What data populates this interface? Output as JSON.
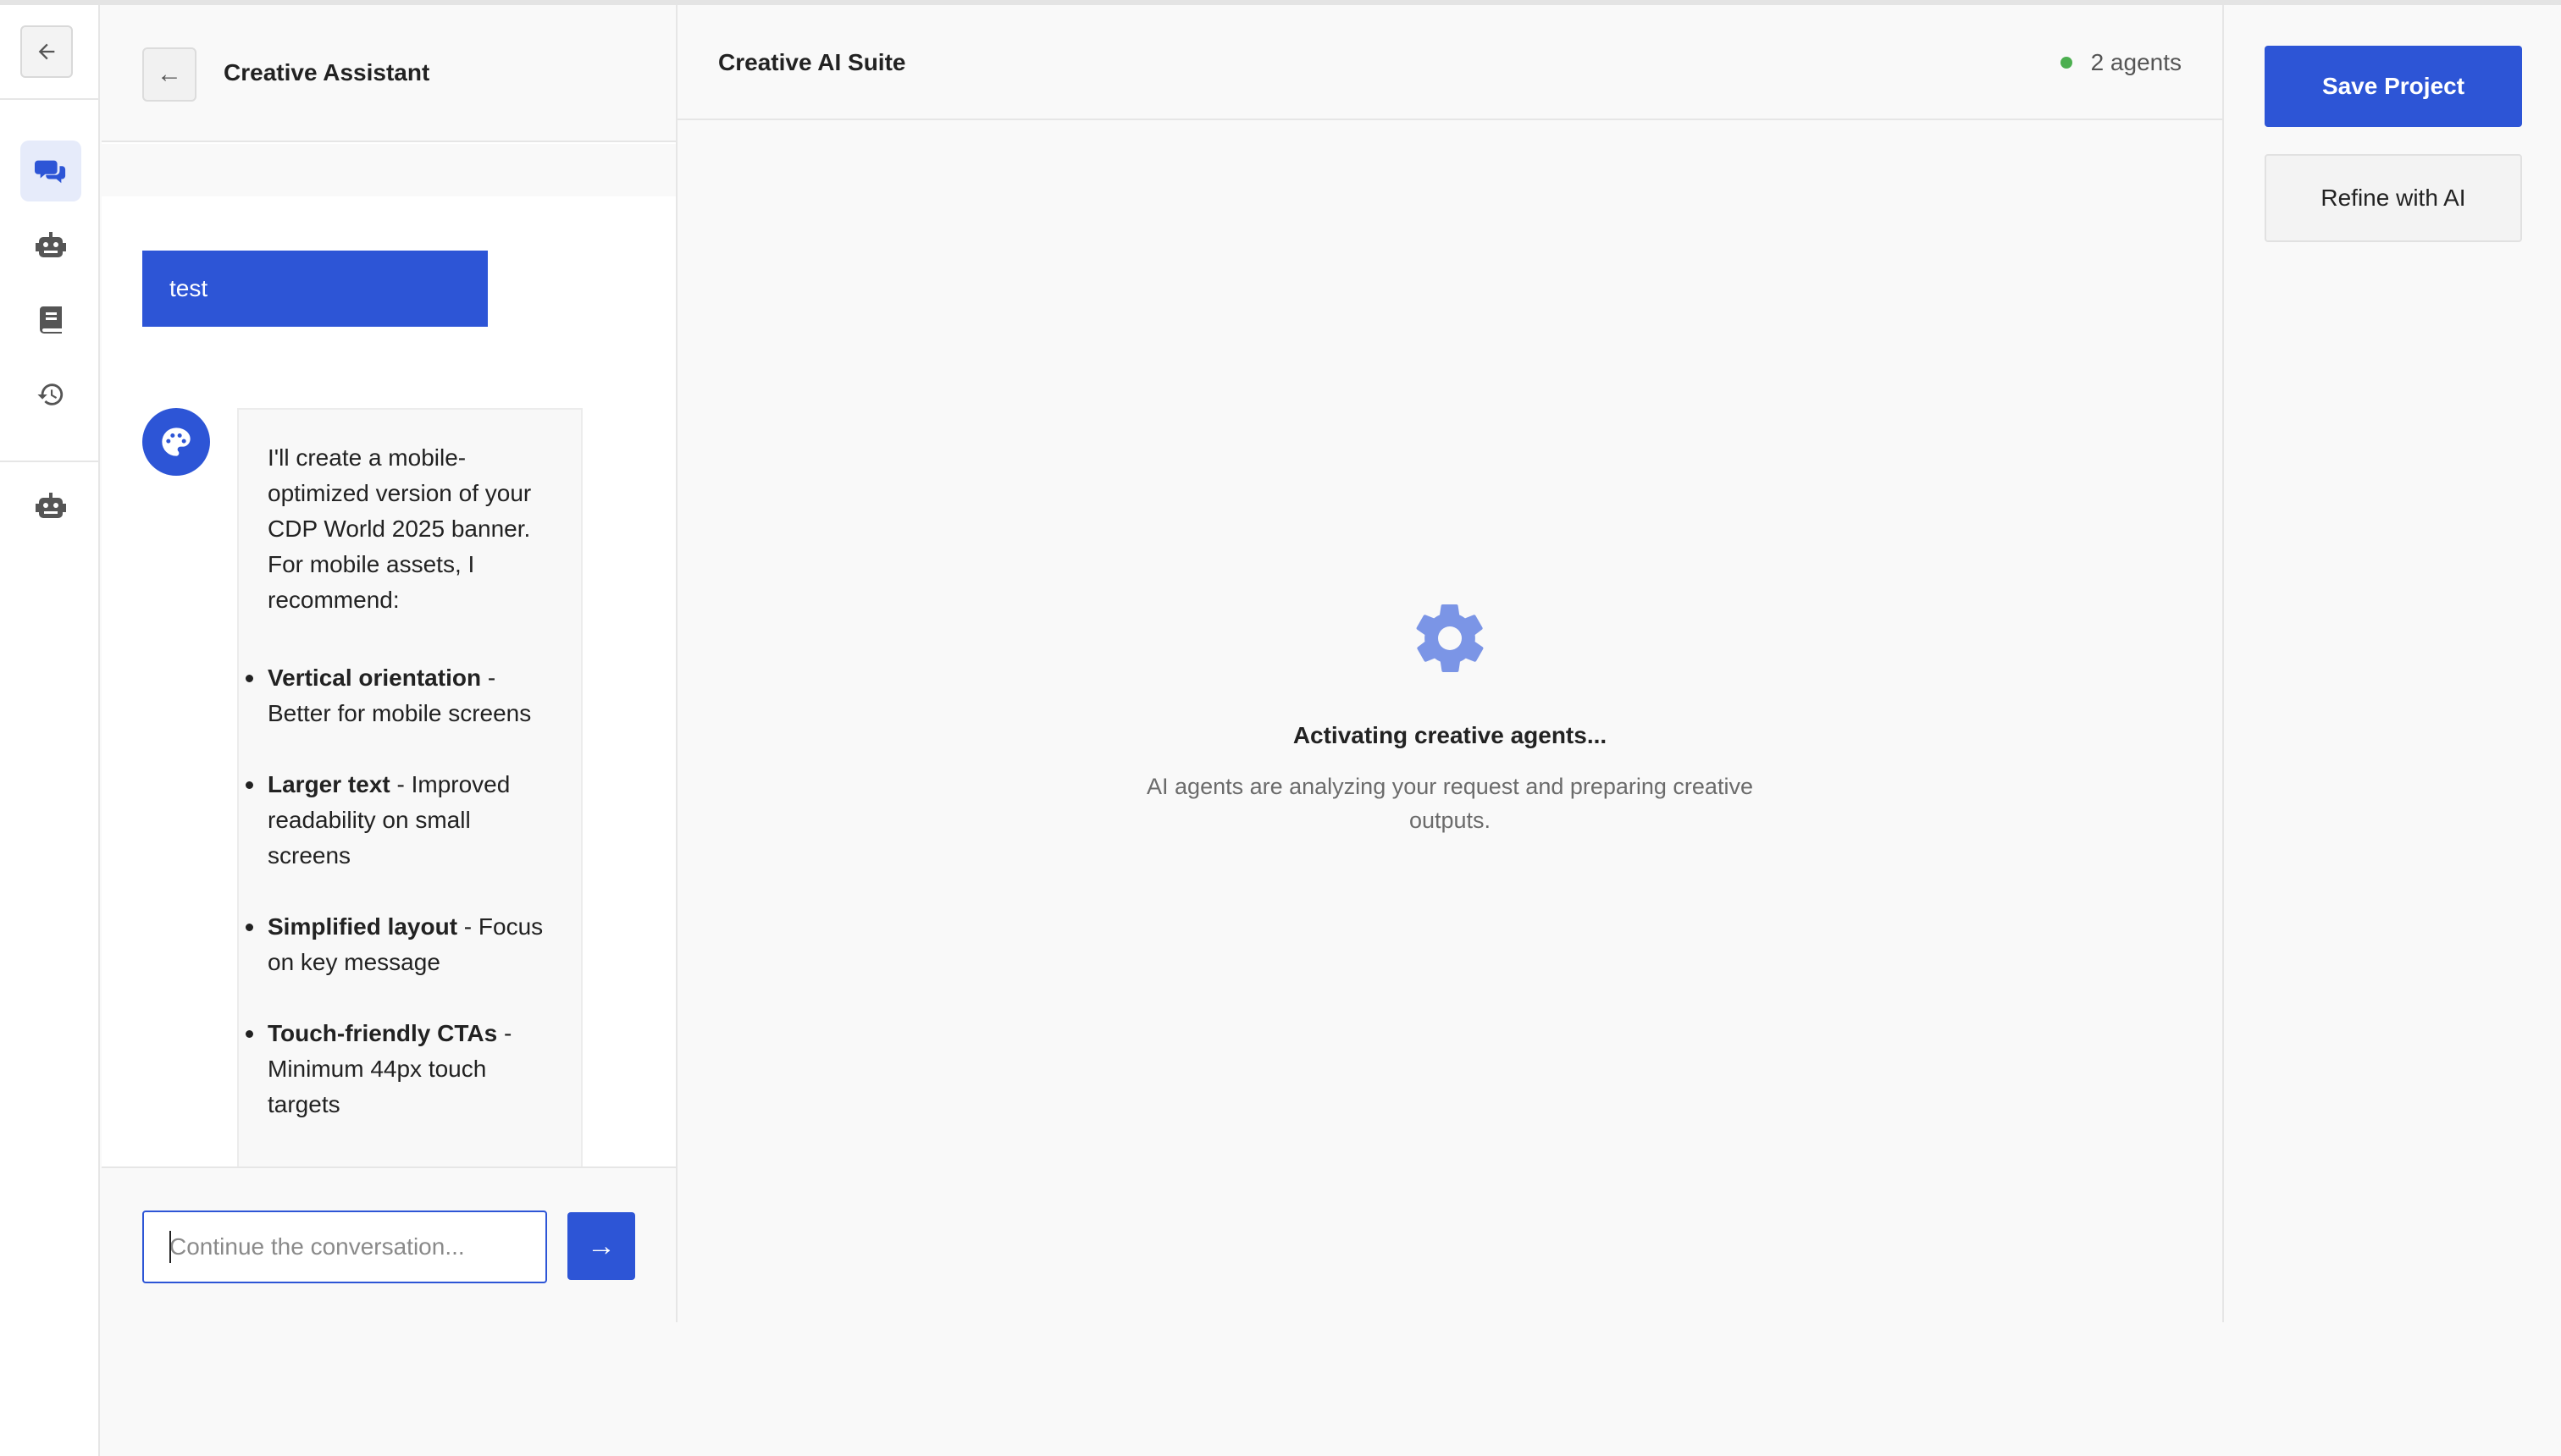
{
  "chat": {
    "title": "Creative Assistant",
    "user_message": "test",
    "assistant_intro": "I'll create a mobile-optimized version of your CDP World 2025 banner. For mobile assets, I recommend:",
    "recommendations": [
      {
        "title": "Vertical orientation",
        "detail": " - Better for mobile screens"
      },
      {
        "title": "Larger text",
        "detail": " - Improved readability on small screens"
      },
      {
        "title": "Simplified layout",
        "detail": " - Focus on key message"
      },
      {
        "title": "Touch-friendly CTAs",
        "detail": " - Minimum 44px touch targets"
      }
    ],
    "input_placeholder": "Continue the conversation...",
    "input_value": "",
    "send_icon": "→"
  },
  "main": {
    "title": "Creative AI Suite",
    "agents_count": "2 agents",
    "loading_title": "Activating creative agents...",
    "loading_subtitle": "AI agents are analyzing your request and preparing creative outputs."
  },
  "actions": {
    "save_label": "Save Project",
    "refine_label": "Refine with AI"
  },
  "nav": {
    "back_icon": "←",
    "items": [
      "chat-icon",
      "robot-icon",
      "book-icon",
      "history-icon",
      "robot-icon"
    ]
  },
  "colors": {
    "accent": "#2d55d6",
    "status_ok": "#4caf50",
    "gear": "#7b95e6"
  }
}
